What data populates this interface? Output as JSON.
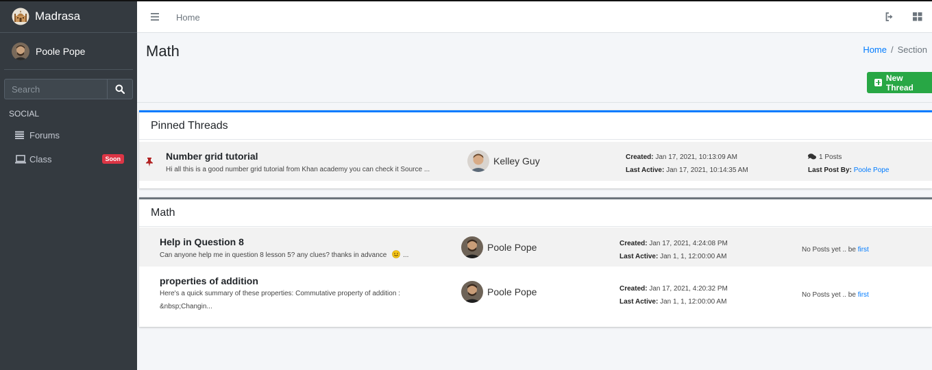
{
  "brand": {
    "name": "Madrasa"
  },
  "user": {
    "name": "Poole Pope"
  },
  "search": {
    "placeholder": "Search"
  },
  "nav": {
    "header": "SOCIAL",
    "items": [
      {
        "label": "Forums",
        "icon": "list-icon"
      },
      {
        "label": "Class",
        "icon": "laptop-icon",
        "badge": "Soon"
      }
    ]
  },
  "topbar": {
    "home": "Home"
  },
  "page": {
    "title": "Math",
    "breadcrumb": {
      "home": "Home",
      "separator": "/",
      "current": "Section"
    },
    "new_thread_label": "New Thread"
  },
  "pinned": {
    "title": "Pinned Threads",
    "threads": [
      {
        "title": "Number grid tutorial",
        "excerpt": "Hi all this is a good number grid tutorial from Khan academy you can check it Source ...",
        "author": "Kelley Guy",
        "created_label": "Created:",
        "created": "Jan 17, 2021, 10:13:09 AM",
        "active_label": "Last Active:",
        "active": "Jan 17, 2021, 10:14:35 AM",
        "posts": "1 Posts",
        "last_post_label": "Last Post By:",
        "last_post_by": "Poole Pope"
      }
    ]
  },
  "section": {
    "title": "Math",
    "threads": [
      {
        "title": "Help in Question 8",
        "excerpt": "Can anyone help me in question 8 lesson 5? any clues? thanks in advance",
        "excerpt_suffix": "...",
        "author": "Poole Pope",
        "created_label": "Created:",
        "created": "Jan 17, 2021, 4:24:08 PM",
        "active_label": "Last Active:",
        "active": "Jan 1, 1, 12:00:00 AM",
        "no_posts": "No Posts yet .. be",
        "first": "first"
      },
      {
        "title": "properties of addition",
        "excerpt_line1": "Here's a quick summary of these properties: Commutative property of addition :",
        "excerpt_line2": "&nbsp;Changin...",
        "author": "Poole Pope",
        "created_label": "Created:",
        "created": "Jan 17, 2021, 4:20:32 PM",
        "active_label": "Last Active:",
        "active": "Jan 1, 1, 12:00:00 AM",
        "no_posts": "No Posts yet .. be",
        "first": "first"
      }
    ]
  },
  "colors": {
    "sidebar": "#343a40",
    "primary": "#007bff",
    "success": "#28a745",
    "danger": "#dc3545",
    "pin": "#b22222"
  }
}
